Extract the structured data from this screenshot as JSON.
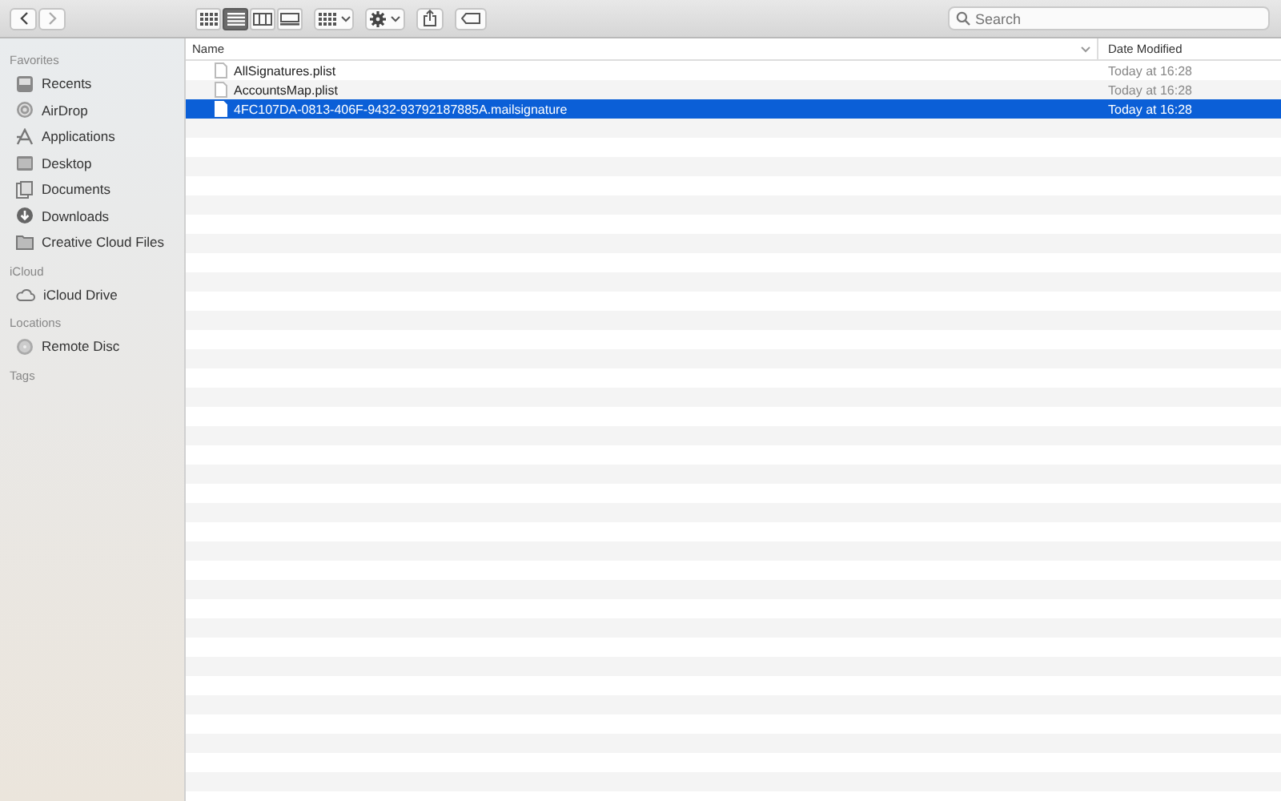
{
  "toolbar": {
    "view_modes": [
      {
        "kind": "icons",
        "selected": false
      },
      {
        "kind": "list",
        "selected": true
      },
      {
        "kind": "columns",
        "selected": false
      },
      {
        "kind": "gallery",
        "selected": false
      }
    ],
    "search": {
      "placeholder": "Search"
    }
  },
  "sidebar": {
    "sections": [
      {
        "title": "Favorites",
        "items": [
          {
            "label": "Recents",
            "kind": "recents"
          },
          {
            "label": "AirDrop",
            "kind": "airdrop"
          },
          {
            "label": "Applications",
            "kind": "applications"
          },
          {
            "label": "Desktop",
            "kind": "desktop"
          },
          {
            "label": "Documents",
            "kind": "documents"
          },
          {
            "label": "Downloads",
            "kind": "downloads"
          },
          {
            "label": "Creative Cloud Files",
            "kind": "folder"
          }
        ]
      },
      {
        "title": "iCloud",
        "items": [
          {
            "label": "iCloud Drive",
            "kind": "cloud"
          }
        ]
      },
      {
        "title": "Locations",
        "items": [
          {
            "label": "Remote Disc",
            "kind": "disc"
          }
        ]
      },
      {
        "title": "Tags"
      }
    ]
  },
  "table": {
    "columns": [
      "Name",
      "Date Modified"
    ],
    "rows": [
      {
        "name": "AllSignatures.plist",
        "date": "Today at 16:28",
        "selected": false
      },
      {
        "name": "AccountsMap.plist",
        "date": "Today at 16:28",
        "selected": false
      },
      {
        "name": "4FC107DA-0813-406F-9432-93792187885A.mailsignature",
        "date": "Today at 16:28",
        "selected": true
      }
    ]
  }
}
